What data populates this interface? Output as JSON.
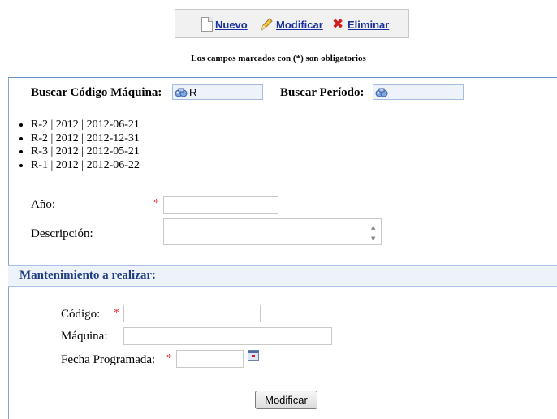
{
  "toolbar": {
    "new_label": "Nuevo",
    "edit_label": "Modificar",
    "delete_label": "Eliminar"
  },
  "required_note": "Los campos marcados con (*) son obligatorios",
  "search": {
    "machine_label": "Buscar Código Máquina:",
    "machine_value": "R",
    "period_label": "Buscar Período:",
    "period_value": ""
  },
  "results": [
    "R-2 | 2012 | 2012-06-21",
    "R-2 | 2012 | 2012-12-31",
    "R-3 | 2012 | 2012-05-21",
    "R-1 | 2012 | 2012-06-22"
  ],
  "form": {
    "year_label": "Año:",
    "year_value": "",
    "description_label": "Descripción:",
    "description_value": "",
    "required_mark": "*"
  },
  "maintenance": {
    "section_title": "Mantenimiento a realizar:",
    "code_label": "Código:",
    "code_value": "",
    "machine_label": "Máquina:",
    "machine_value": "",
    "date_label": "Fecha Programada:",
    "date_value": ""
  },
  "submit_label": "Modificar",
  "colors": {
    "link": "#1a2fa0",
    "required": "#e03030",
    "section_title": "#1f3f7f",
    "section_bg": "#eef3fb"
  }
}
